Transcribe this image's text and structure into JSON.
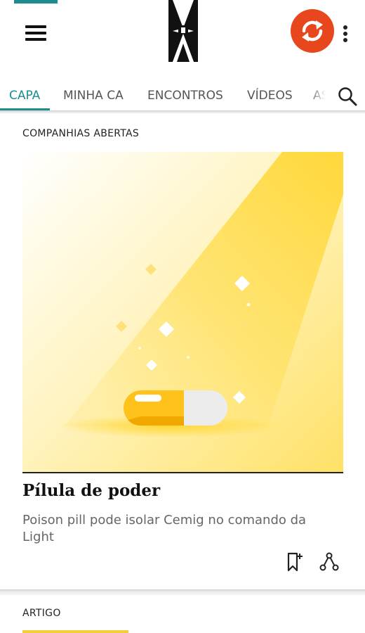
{
  "header": {
    "menu_icon": "hamburger-menu-icon",
    "logo_icon": "publication-logo-icon",
    "sync_icon": "sync-arrows-icon",
    "overflow_icon": "vertical-ellipsis-icon",
    "accent_color": "#1f8c8f",
    "sync_color": "#e8461c"
  },
  "tabs": {
    "items": [
      {
        "label": "CAPA",
        "active": true
      },
      {
        "label": "MINHA CA"
      },
      {
        "label": "ENCONTROS"
      },
      {
        "label": "VÍDEOS"
      },
      {
        "label": "AS"
      }
    ],
    "search_icon": "search-icon"
  },
  "feed": {
    "card": {
      "section": "COMPANHIAS ABERTAS",
      "image_icon": "pill-spotlight-illustration",
      "title": "Pílula de poder",
      "summary": "Poison pill pode isolar Cemig no comando da Light",
      "bookmark_icon": "bookmark-add-icon",
      "share_icon": "share-icon"
    },
    "next_card": {
      "section": "ARTIGO",
      "accent_color": "#f2cf3a"
    }
  }
}
